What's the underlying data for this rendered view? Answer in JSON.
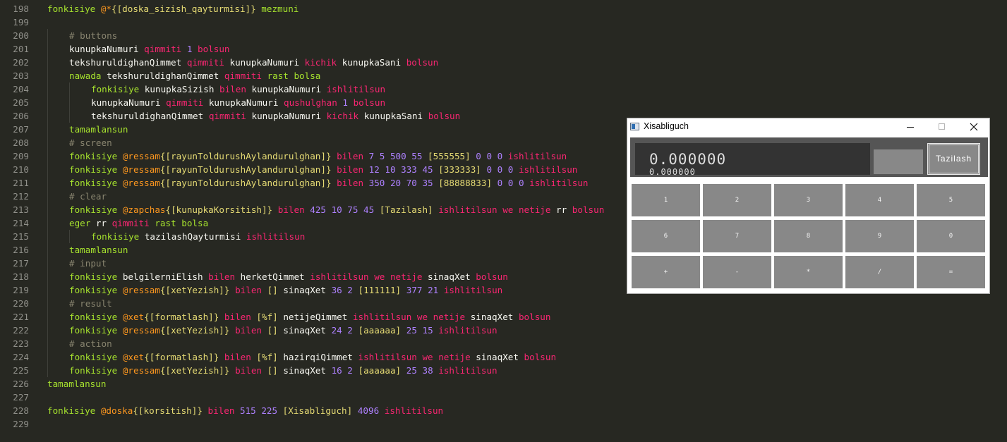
{
  "editor": {
    "lines": [
      {
        "n": "198",
        "indent": 0,
        "tokens": [
          [
            "fn",
            "fonkisiye "
          ],
          [
            "at",
            "@*"
          ],
          [
            "br",
            "{[doska_sizish_qayturmisi]}"
          ],
          [
            "fn",
            " mezmuni"
          ]
        ]
      },
      {
        "n": "199",
        "indent": 0,
        "tokens": []
      },
      {
        "n": "200",
        "indent": 1,
        "tokens": [
          [
            "com",
            "# buttons"
          ]
        ]
      },
      {
        "n": "201",
        "indent": 1,
        "tokens": [
          [
            "ident",
            "kunupkaNumuri "
          ],
          [
            "kw",
            "qimmiti "
          ],
          [
            "num",
            "1 "
          ],
          [
            "kw",
            "bolsun"
          ]
        ]
      },
      {
        "n": "202",
        "indent": 1,
        "tokens": [
          [
            "ident",
            "tekshuruldighanQimmet "
          ],
          [
            "kw",
            "qimmiti "
          ],
          [
            "ident",
            "kunupkaNumuri "
          ],
          [
            "kw",
            "kichik "
          ],
          [
            "ident",
            "kunupkaSani "
          ],
          [
            "kw",
            "bolsun"
          ]
        ]
      },
      {
        "n": "203",
        "indent": 1,
        "tokens": [
          [
            "fn",
            "nawada "
          ],
          [
            "ident",
            "tekshuruldighanQimmet "
          ],
          [
            "kw",
            "qimmiti "
          ],
          [
            "fn",
            "rast bolsa"
          ]
        ]
      },
      {
        "n": "204",
        "indent": 2,
        "tokens": [
          [
            "fn",
            "fonkisiye "
          ],
          [
            "ident",
            "kunupkaSizish "
          ],
          [
            "kw",
            "bilen "
          ],
          [
            "ident",
            "kunupkaNumuri "
          ],
          [
            "kw",
            "ishlitilsun"
          ]
        ]
      },
      {
        "n": "205",
        "indent": 2,
        "tokens": [
          [
            "ident",
            "kunupkaNumuri "
          ],
          [
            "kw",
            "qimmiti "
          ],
          [
            "ident",
            "kunupkaNumuri "
          ],
          [
            "kw",
            "qushulghan "
          ],
          [
            "num",
            "1 "
          ],
          [
            "kw",
            "bolsun"
          ]
        ]
      },
      {
        "n": "206",
        "indent": 2,
        "tokens": [
          [
            "ident",
            "tekshuruldighanQimmet "
          ],
          [
            "kw",
            "qimmiti "
          ],
          [
            "ident",
            "kunupkaNumuri "
          ],
          [
            "kw",
            "kichik "
          ],
          [
            "ident",
            "kunupkaSani "
          ],
          [
            "kw",
            "bolsun"
          ]
        ]
      },
      {
        "n": "207",
        "indent": 1,
        "tokens": [
          [
            "fn",
            "tamamlansun"
          ]
        ]
      },
      {
        "n": "208",
        "indent": 1,
        "tokens": [
          [
            "com",
            "# screen"
          ]
        ]
      },
      {
        "n": "209",
        "indent": 1,
        "tokens": [
          [
            "fn",
            "fonkisiye "
          ],
          [
            "at",
            "@ressam"
          ],
          [
            "br",
            "{[rayunToldurushAylandurulghan]}"
          ],
          [
            "kw",
            " bilen "
          ],
          [
            "num",
            "7 5 500 55 "
          ],
          [
            "br",
            "[555555]"
          ],
          [
            "num",
            " 0 0 0 "
          ],
          [
            "kw",
            "ishlitilsun"
          ]
        ]
      },
      {
        "n": "210",
        "indent": 1,
        "tokens": [
          [
            "fn",
            "fonkisiye "
          ],
          [
            "at",
            "@ressam"
          ],
          [
            "br",
            "{[rayunToldurushAylandurulghan]}"
          ],
          [
            "kw",
            " bilen "
          ],
          [
            "num",
            "12 10 333 45 "
          ],
          [
            "br",
            "[333333]"
          ],
          [
            "num",
            " 0 0 0 "
          ],
          [
            "kw",
            "ishlitilsun"
          ]
        ]
      },
      {
        "n": "211",
        "indent": 1,
        "tokens": [
          [
            "fn",
            "fonkisiye "
          ],
          [
            "at",
            "@ressam"
          ],
          [
            "br",
            "{[rayunToldurushAylandurulghan]}"
          ],
          [
            "kw",
            " bilen "
          ],
          [
            "num",
            "350 20 70 35 "
          ],
          [
            "br",
            "[88888833]"
          ],
          [
            "num",
            " 0 0 0 "
          ],
          [
            "kw",
            "ishlitilsun"
          ]
        ]
      },
      {
        "n": "212",
        "indent": 1,
        "tokens": [
          [
            "com",
            "# clear"
          ]
        ]
      },
      {
        "n": "213",
        "indent": 1,
        "tokens": [
          [
            "fn",
            "fonkisiye "
          ],
          [
            "at",
            "@zapchas"
          ],
          [
            "br",
            "{[kunupkaKorsitish]}"
          ],
          [
            "kw",
            " bilen "
          ],
          [
            "num",
            "425 10 75 45 "
          ],
          [
            "br",
            "[Tazilash]"
          ],
          [
            "kw",
            " ishlitilsun we netije "
          ],
          [
            "ident",
            "rr "
          ],
          [
            "kw",
            "bolsun"
          ]
        ]
      },
      {
        "n": "214",
        "indent": 1,
        "tokens": [
          [
            "fn",
            "eger "
          ],
          [
            "ident",
            "rr "
          ],
          [
            "kw",
            "qimmiti "
          ],
          [
            "fn",
            "rast bolsa"
          ]
        ]
      },
      {
        "n": "215",
        "indent": 2,
        "tokens": [
          [
            "fn",
            "fonkisiye "
          ],
          [
            "ident",
            "tazilashQayturmisi "
          ],
          [
            "kw",
            "ishlitilsun"
          ]
        ]
      },
      {
        "n": "216",
        "indent": 1,
        "tokens": [
          [
            "fn",
            "tamamlansun"
          ]
        ]
      },
      {
        "n": "217",
        "indent": 1,
        "tokens": [
          [
            "com",
            "# input"
          ]
        ]
      },
      {
        "n": "218",
        "indent": 1,
        "tokens": [
          [
            "fn",
            "fonkisiye "
          ],
          [
            "ident",
            "belgilerniElish "
          ],
          [
            "kw",
            "bilen "
          ],
          [
            "ident",
            "herketQimmet "
          ],
          [
            "kw",
            "ishlitilsun we netije "
          ],
          [
            "ident",
            "sinaqXet "
          ],
          [
            "kw",
            "bolsun"
          ]
        ]
      },
      {
        "n": "219",
        "indent": 1,
        "tokens": [
          [
            "fn",
            "fonkisiye "
          ],
          [
            "at",
            "@ressam"
          ],
          [
            "br",
            "{[xetYezish]}"
          ],
          [
            "kw",
            " bilen "
          ],
          [
            "br",
            "[]"
          ],
          [
            "ident",
            " sinaqXet "
          ],
          [
            "num",
            "36 2 "
          ],
          [
            "br",
            "[111111]"
          ],
          [
            "num",
            " 377 21 "
          ],
          [
            "kw",
            "ishlitilsun"
          ]
        ]
      },
      {
        "n": "220",
        "indent": 1,
        "tokens": [
          [
            "com",
            "# result"
          ]
        ]
      },
      {
        "n": "221",
        "indent": 1,
        "tokens": [
          [
            "fn",
            "fonkisiye "
          ],
          [
            "at",
            "@xet"
          ],
          [
            "br",
            "{[formatlash]}"
          ],
          [
            "kw",
            " bilen "
          ],
          [
            "br",
            "[%f]"
          ],
          [
            "ident",
            " netijeQimmet "
          ],
          [
            "kw",
            "ishlitilsun we netije "
          ],
          [
            "ident",
            "sinaqXet "
          ],
          [
            "kw",
            "bolsun"
          ]
        ]
      },
      {
        "n": "222",
        "indent": 1,
        "tokens": [
          [
            "fn",
            "fonkisiye "
          ],
          [
            "at",
            "@ressam"
          ],
          [
            "br",
            "{[xetYezish]}"
          ],
          [
            "kw",
            " bilen "
          ],
          [
            "br",
            "[]"
          ],
          [
            "ident",
            " sinaqXet "
          ],
          [
            "num",
            "24 2 "
          ],
          [
            "br",
            "[aaaaaa]"
          ],
          [
            "num",
            " 25 15 "
          ],
          [
            "kw",
            "ishlitilsun"
          ]
        ]
      },
      {
        "n": "223",
        "indent": 1,
        "tokens": [
          [
            "com",
            "# action"
          ]
        ]
      },
      {
        "n": "224",
        "indent": 1,
        "tokens": [
          [
            "fn",
            "fonkisiye "
          ],
          [
            "at",
            "@xet"
          ],
          [
            "br",
            "{[formatlash]}"
          ],
          [
            "kw",
            " bilen "
          ],
          [
            "br",
            "[%f]"
          ],
          [
            "ident",
            " hazirqiQimmet "
          ],
          [
            "kw",
            "ishlitilsun we netije "
          ],
          [
            "ident",
            "sinaqXet "
          ],
          [
            "kw",
            "bolsun"
          ]
        ]
      },
      {
        "n": "225",
        "indent": 1,
        "tokens": [
          [
            "fn",
            "fonkisiye "
          ],
          [
            "at",
            "@ressam"
          ],
          [
            "br",
            "{[xetYezish]}"
          ],
          [
            "kw",
            " bilen "
          ],
          [
            "br",
            "[]"
          ],
          [
            "ident",
            " sinaqXet "
          ],
          [
            "num",
            "16 2 "
          ],
          [
            "br",
            "[aaaaaa]"
          ],
          [
            "num",
            " 25 38 "
          ],
          [
            "kw",
            "ishlitilsun"
          ]
        ]
      },
      {
        "n": "226",
        "indent": 0,
        "tokens": [
          [
            "fn",
            "tamamlansun"
          ]
        ]
      },
      {
        "n": "227",
        "indent": 0,
        "tokens": []
      },
      {
        "n": "228",
        "indent": 0,
        "tokens": [
          [
            "fn",
            "fonkisiye "
          ],
          [
            "at",
            "@doska"
          ],
          [
            "br",
            "{[korsitish]}"
          ],
          [
            "kw",
            " bilen "
          ],
          [
            "num",
            "515 225 "
          ],
          [
            "br",
            "[Xisabliguch]"
          ],
          [
            "num",
            " 4096 "
          ],
          [
            "kw",
            "ishlitilsun"
          ]
        ]
      },
      {
        "n": "229",
        "indent": 0,
        "tokens": []
      }
    ]
  },
  "calculator": {
    "title": "Xisabliguch",
    "readout_main": "0.000000",
    "readout_small": "0.000000",
    "clear_label": "Tazilash",
    "keys": [
      "1",
      "2",
      "3",
      "4",
      "5",
      "6",
      "7",
      "8",
      "9",
      "0",
      "+",
      "-",
      "*",
      "/",
      "="
    ]
  },
  "colors": {
    "editor_bg": "#272822",
    "keyword": "#f92672",
    "function": "#a6e22e",
    "number": "#ae81ff",
    "comment": "#88846f",
    "decorator": "#fd971f",
    "string": "#e6db74",
    "button_gray": "#888888"
  }
}
